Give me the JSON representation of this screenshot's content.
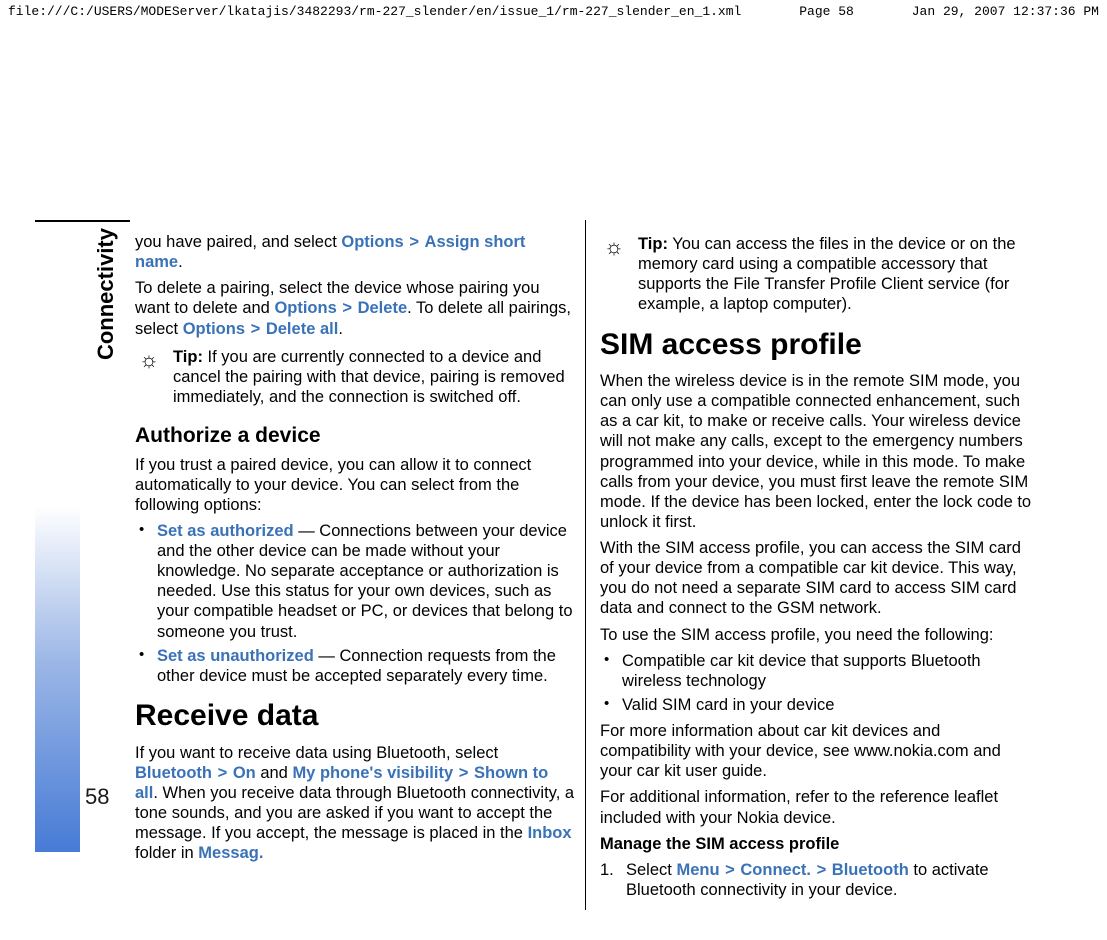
{
  "header": {
    "path": "file:///C:/USERS/MODEServer/lkatajis/3482293/rm-227_slender/en/issue_1/rm-227_slender_en_1.xml",
    "page": "Page 58",
    "date": "Jan 29, 2007 12:37:36 PM"
  },
  "sidebar": {
    "section_title": "Connectivity",
    "page_number": "58"
  },
  "left": {
    "p1_a": "you have paired, and select ",
    "p1_opt": "Options",
    "gt": ">",
    "p1_b": "Assign short name",
    "p1_c": ".",
    "p2_a": "To delete a pairing, select the device whose pairing you want to delete and ",
    "p2_opt": "Options",
    "p2_del": "Delete",
    "p2_b": ". To delete all pairings, select ",
    "p2_opt2": "Options",
    "p2_delall": "Delete all",
    "p2_c": ".",
    "tip_icon_glyph": "☼",
    "tip1_label": "Tip:",
    "tip1_text": " If you are currently connected to a device and cancel the pairing with that device, pairing is removed immediately, and the connection is switched off.",
    "h_authorize": "Authorize a device",
    "p3": "If you trust a paired device, you can allow it to connect automatically to your device. You can select from the following options:",
    "opt1_kw": "Set as authorized",
    "opt1_txt": " — Connections between your device and the other device can be made without your knowledge. No separate acceptance or authorization is needed. Use this status for your own devices, such as your compatible headset or PC, or devices that belong to someone you trust.",
    "opt2_kw": "Set as unauthorized",
    "opt2_txt": " — Connection requests from the other device must be accepted separately every time.",
    "h_receive": "Receive data",
    "p4_a": "If you want to receive data using Bluetooth, select ",
    "p4_bt": "Bluetooth",
    "p4_on": "On",
    "p4_and": " and ",
    "p4_vis": "My phone's visibility",
    "p4_shown": "Shown to all",
    "p4_b": ". When you receive data through Bluetooth connectivity, a tone sounds, and you are asked if you want to accept the message. If you accept, the message is placed in the ",
    "p4_inbox": "Inbox",
    "p4_c": " folder in ",
    "p4_messag": "Messag.",
    "p4_d": ""
  },
  "right": {
    "tip2_label": "Tip:",
    "tip2_text": " You can access the files in the device or on the memory card using a compatible accessory that supports the File Transfer Profile Client service (for example, a laptop computer).",
    "h_sim": "SIM access profile",
    "p5": "When the wireless device is in the remote SIM mode, you can only use a compatible connected enhancement, such as a car kit, to make or receive calls. Your wireless device will not make any calls, except to the emergency numbers programmed into your device, while in this mode. To make calls from your device, you must first leave the remote SIM mode. If the device has been locked, enter the lock code to unlock it first.",
    "p6": "With the SIM access profile, you can access the SIM card of your device from a compatible car kit device. This way, you do not need a separate SIM card to access SIM card data and connect to the GSM network.",
    "p7": "To use the SIM access profile, you need the following:",
    "req1": "Compatible car kit device that supports Bluetooth wireless technology",
    "req2": "Valid SIM card in your device",
    "p8": "For more information about car kit devices and compatibility with your device, see www.nokia.com and your car kit user guide.",
    "p9": "For additional information, refer to the reference leaflet included with your Nokia device.",
    "p10_bold": "Manage the SIM access profile",
    "step1_num": "1.",
    "step1_a": "Select ",
    "step1_menu": "Menu",
    "step1_connect": "Connect.",
    "step1_bt": "Bluetooth",
    "step1_b": " to activate Bluetooth connectivity in your device."
  }
}
